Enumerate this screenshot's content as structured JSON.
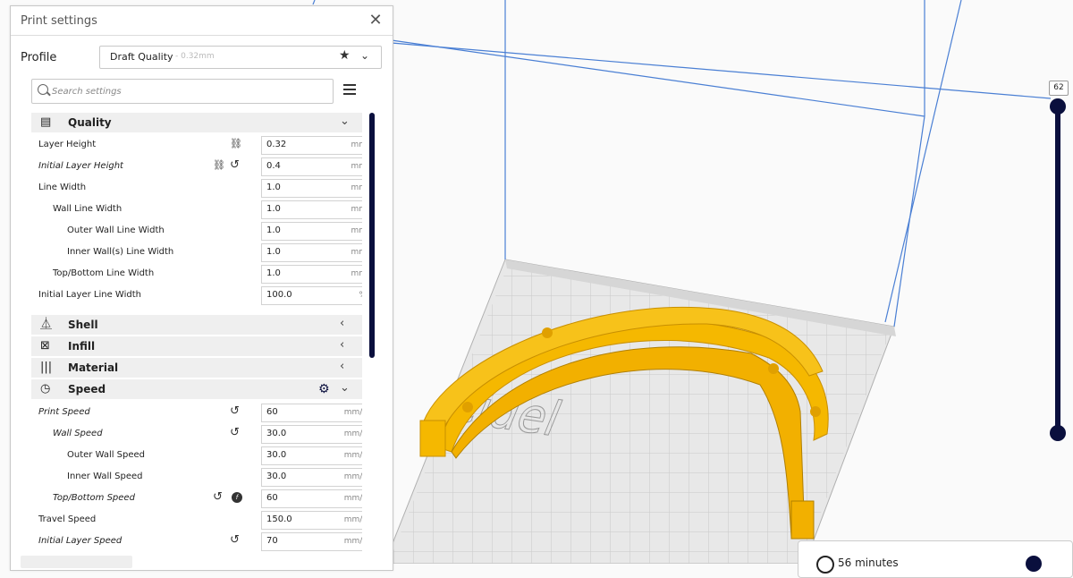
{
  "panel": {
    "title": "Print settings",
    "close_icon": "close-icon"
  },
  "profile": {
    "label": "Profile",
    "name": "Draft Quality",
    "sub": "- 0.32mm",
    "favorite_icon": "star-icon",
    "chevron_icon": "chevron-down-icon"
  },
  "search": {
    "placeholder": "Search settings"
  },
  "categories": {
    "quality": {
      "label": "Quality",
      "icon": "quality-icon",
      "expanded": true
    },
    "shell": {
      "label": "Shell",
      "icon": "shell-icon",
      "expanded": false
    },
    "infill": {
      "label": "Infill",
      "icon": "infill-icon",
      "expanded": false
    },
    "material": {
      "label": "Material",
      "icon": "material-icon",
      "expanded": false
    },
    "speed": {
      "label": "Speed",
      "icon": "speed-icon",
      "expanded": true
    }
  },
  "quality_settings": [
    {
      "label": "Layer Height",
      "value": "0.32",
      "unit": "mm"
    },
    {
      "label": "Initial Layer Height",
      "value": "0.4",
      "unit": "mm"
    },
    {
      "label": "Line Width",
      "value": "1.0",
      "unit": "mm"
    },
    {
      "label": "Wall Line Width",
      "value": "1.0",
      "unit": "mm"
    },
    {
      "label": "Outer Wall Line Width",
      "value": "1.0",
      "unit": "mm"
    },
    {
      "label": "Inner Wall(s) Line Width",
      "value": "1.0",
      "unit": "mm"
    },
    {
      "label": "Top/Bottom Line Width",
      "value": "1.0",
      "unit": "mm"
    },
    {
      "label": "Initial Layer Line Width",
      "value": "100.0",
      "unit": "%"
    }
  ],
  "speed_settings": [
    {
      "label": "Print Speed",
      "value": "60",
      "unit": "mm/s"
    },
    {
      "label": "Wall Speed",
      "value": "30.0",
      "unit": "mm/s"
    },
    {
      "label": "Outer Wall Speed",
      "value": "30.0",
      "unit": "mm/s"
    },
    {
      "label": "Inner Wall Speed",
      "value": "30.0",
      "unit": "mm/s"
    },
    {
      "label": "Top/Bottom Speed",
      "value": "60",
      "unit": "mm/s"
    },
    {
      "label": "Travel Speed",
      "value": "150.0",
      "unit": "mm/s"
    },
    {
      "label": "Initial Layer Speed",
      "value": "70",
      "unit": "mm/s"
    }
  ],
  "layer_slider": {
    "current_layer": "62"
  },
  "estimate": {
    "text": "56 minutes"
  },
  "colors": {
    "model": "#f5b800",
    "accent": "#0a0f3d",
    "build_edge": "#4a7fd4"
  }
}
